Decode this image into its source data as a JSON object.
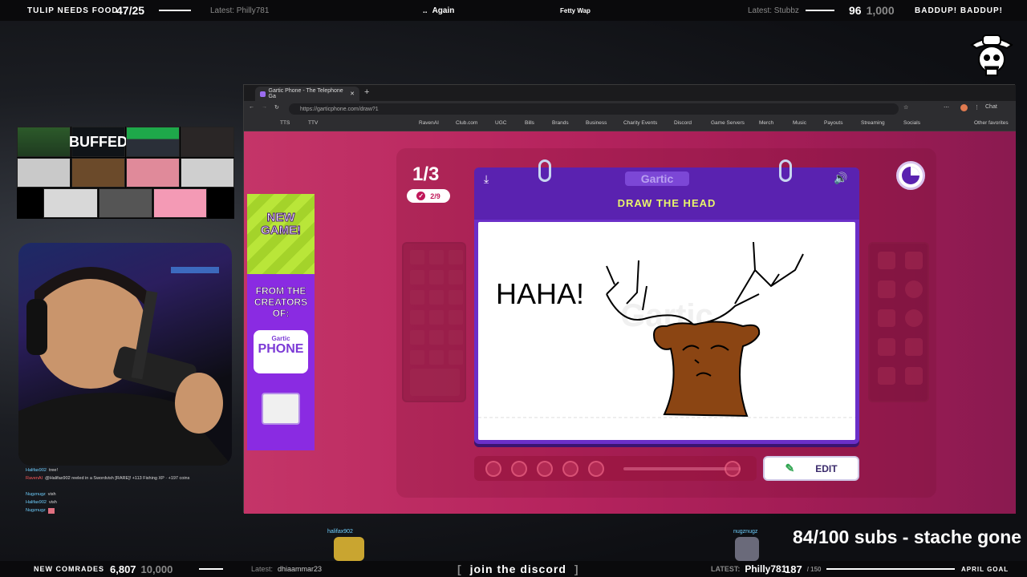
{
  "top_bar": {
    "left_label": "TULIP NEEDS FOOD",
    "left_count": "47/25",
    "left_latest": "Latest: Philly781",
    "now_playing_prefix": "..",
    "now_playing_title": "Again",
    "now_playing_artist": "Fetty Wap",
    "right_latest": "Latest: Stubbz",
    "right_count": "96",
    "right_goal": "1,000",
    "right_label": "BADDUP! BADDUP!"
  },
  "webcam_chat": [
    {
      "user": "Halifax902",
      "message": "tree!"
    },
    {
      "user": "RavenAI",
      "message": "@Halifax902 reeled in a Swordvish [RARE]! +113 Fishing XP · +197 coins"
    },
    {
      "user": "Nugznugz",
      "message": "vish"
    },
    {
      "user": "Halifax902",
      "message": "vish"
    },
    {
      "user": "Nugznugz",
      "message": ""
    }
  ],
  "grid_tiles": [
    "",
    "BUFFED",
    "",
    "",
    "",
    "",
    "",
    "",
    "",
    "",
    ""
  ],
  "browser": {
    "tab_title": "Gartic Phone - The Telephone Ga",
    "url": "https://garticphone.com/draw?1",
    "bookmarks": [
      "TTS",
      "TTV",
      "RavenAI",
      "Club.com",
      "UGC",
      "Bills",
      "Brands",
      "Business",
      "Charity Events",
      "Discord",
      "Game Servers",
      "Merch",
      "Music",
      "Payouts",
      "Streaming",
      "Socials"
    ],
    "other_favorites": "Other favorites",
    "chat_label": "Chat"
  },
  "ad": {
    "line1": "NEW GAME!",
    "line2": "FROM THE CREATORS OF:",
    "logo_small": "Gartic",
    "logo_big": "PHONE"
  },
  "game": {
    "round": "1/3",
    "votes": "2/9",
    "logo": "Gartic",
    "prompt": "DRAW THE HEAD",
    "canvas_text": "HAHA!",
    "edit_label": "EDIT"
  },
  "overlay": {
    "user_left": "halifax902",
    "user_right": "nugznugz",
    "subs_goal": "84/100 subs - stache gone"
  },
  "bottom_bar": {
    "left_label": "NEW COMRADES",
    "left_count": "6,807",
    "left_goal": "10,000",
    "left_latest_prefix": "Latest:",
    "left_latest": "dhiaammar23",
    "discord": "join the discord",
    "right_latest_prefix": "LATEST:",
    "right_latest": "Philly781",
    "right_count": "187",
    "right_goal": "/ 150",
    "right_label": "APRIL GOAL"
  },
  "colors": {
    "page_pink": "#b6245e",
    "card_purple": "#6b2fc8",
    "prompt_yellow": "#e8f56a",
    "antler_brown": "#8b4513"
  }
}
